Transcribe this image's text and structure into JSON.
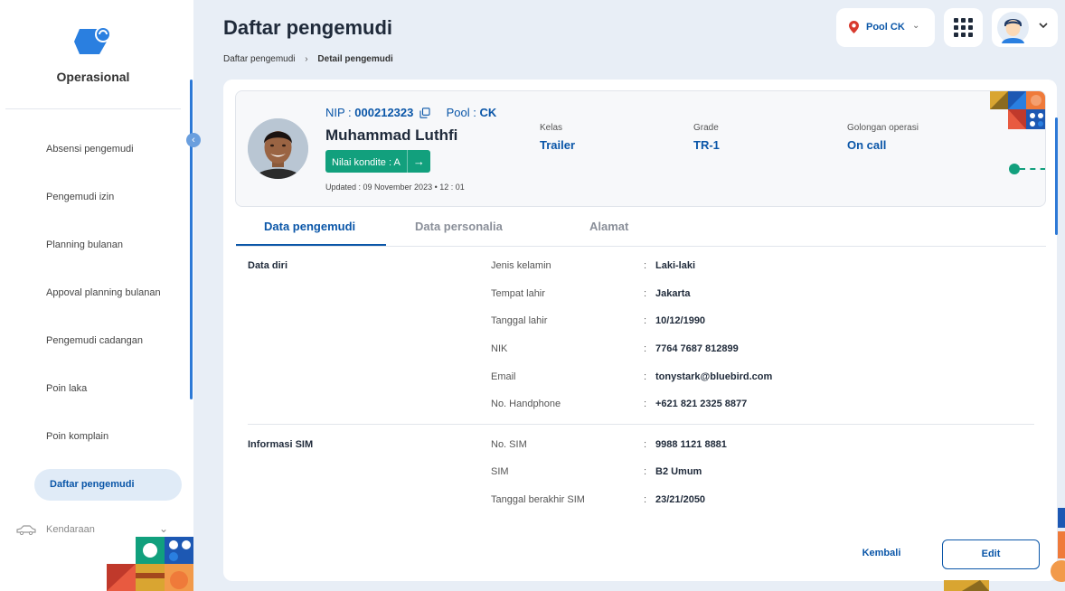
{
  "app": {
    "name": "Operasional"
  },
  "sidebar": {
    "items": [
      {
        "label": "Absensi pengemudi"
      },
      {
        "label": "Pengemudi izin"
      },
      {
        "label": "Planning bulanan"
      },
      {
        "label": "Appoval planning bulanan"
      },
      {
        "label": "Pengemudi cadangan"
      },
      {
        "label": "Poin laka"
      },
      {
        "label": "Poin komplain"
      },
      {
        "label": "Daftar pengemudi",
        "active": true
      }
    ],
    "sub_section": {
      "label": "Kendaraan",
      "icon": "car-icon"
    }
  },
  "header": {
    "title": "Daftar pengemudi",
    "breadcrumb": [
      "Daftar pengemudi",
      "Detail pengemudi"
    ],
    "pool_selector": {
      "label": "Pool CK",
      "icon": "location-pin-icon"
    },
    "apps_icon": "grid-icon",
    "user_icon": "avatar-icon"
  },
  "profile": {
    "nip_label": "NIP :",
    "nip_value": "000212323",
    "pool_label": "Pool :",
    "pool_value": "CK",
    "name": "Muhammad Luthfi",
    "nilai_kondite": "Nilai kondite : A",
    "updated": "Updated : 09 November 2023 • 12 : 01",
    "kelas": {
      "label": "Kelas",
      "value": "Trailer"
    },
    "grade": {
      "label": "Grade",
      "value": "TR-1"
    },
    "golongan": {
      "label": "Golongan operasi",
      "value": "On call"
    }
  },
  "tabs": [
    {
      "label": "Data pengemudi",
      "active": true
    },
    {
      "label": "Data personalia"
    },
    {
      "label": "Alamat"
    }
  ],
  "sections": [
    {
      "title": "Data diri",
      "rows": [
        {
          "label": "Jenis kelamin",
          "value": "Laki-laki"
        },
        {
          "label": "Tempat lahir",
          "value": "Jakarta"
        },
        {
          "label": "Tanggal lahir",
          "value": "10/12/1990"
        },
        {
          "label": "NIK",
          "value": "7764 7687 812899"
        },
        {
          "label": "Email",
          "value": "tonystark@bluebird.com"
        },
        {
          "label": "No. Handphone",
          "value": "+621 821 2325 8877"
        }
      ]
    },
    {
      "title": "Informasi SIM",
      "rows": [
        {
          "label": "No. SIM",
          "value": "9988 1121 8881"
        },
        {
          "label": "SIM",
          "value": "B2 Umum"
        },
        {
          "label": "Tanggal berakhir SIM",
          "value": "23/21/2050"
        }
      ]
    }
  ],
  "actions": {
    "back": "Kembali",
    "edit": "Edit"
  },
  "colors": {
    "primary": "#0a56a8",
    "accent_green": "#12a07d",
    "background": "#e8eef6"
  }
}
